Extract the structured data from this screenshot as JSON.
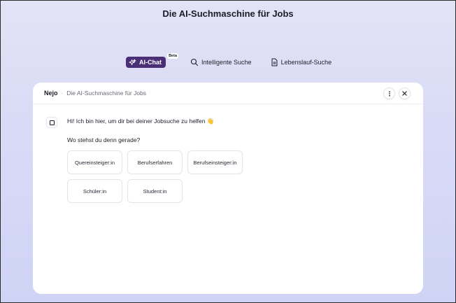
{
  "page": {
    "title": "Die AI-Suchmaschine für Jobs"
  },
  "tabs": {
    "ai_chat": "AI-Chat",
    "beta": "Beta",
    "smart_search": "Intelligente Suche",
    "cv_search": "Lebenslauf-Suche"
  },
  "chat": {
    "brand": "Nejo",
    "separator": "·",
    "subtitle": "Die AI-Suchmaschine für Jobs",
    "greeting": "Hi! Ich bin hier, um dir bei deiner Jobsuche zu helfen 👋",
    "question": "Wo stehst du denn gerade?",
    "options": [
      "Quereinsteiger:in",
      "Berufserfahren",
      "Berufseinsteiger:in",
      "Schüler:in",
      "Student:in"
    ]
  },
  "colors": {
    "accent": "#4a2f77",
    "background": "#d9dbf6"
  },
  "icons": {
    "ai": "sparkle-icon",
    "search": "magnifier-icon",
    "cv": "document-icon",
    "more": "more-vertical-icon",
    "close": "close-icon",
    "avatar": "square-icon"
  }
}
